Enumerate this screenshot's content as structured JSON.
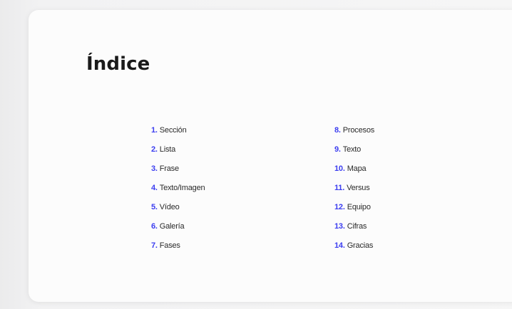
{
  "slide": {
    "title": "Índice",
    "accent_color": "#3b3df0",
    "left_items": [
      {
        "num": "1.",
        "label": "Sección"
      },
      {
        "num": "2.",
        "label": "Lista"
      },
      {
        "num": "3.",
        "label": "Frase"
      },
      {
        "num": "4.",
        "label": "Texto/Imagen"
      },
      {
        "num": "5.",
        "label": "Vídeo"
      },
      {
        "num": "6.",
        "label": "Galería"
      },
      {
        "num": "7.",
        "label": "Fases"
      }
    ],
    "right_items": [
      {
        "num": "8.",
        "label": "Procesos"
      },
      {
        "num": "9.",
        "label": "Texto"
      },
      {
        "num": "10.",
        "label": "Mapa"
      },
      {
        "num": "11.",
        "label": "Versus"
      },
      {
        "num": "12.",
        "label": "Equipo"
      },
      {
        "num": "13.",
        "label": "Cifras"
      },
      {
        "num": "14.",
        "label": "Gracias"
      }
    ]
  }
}
